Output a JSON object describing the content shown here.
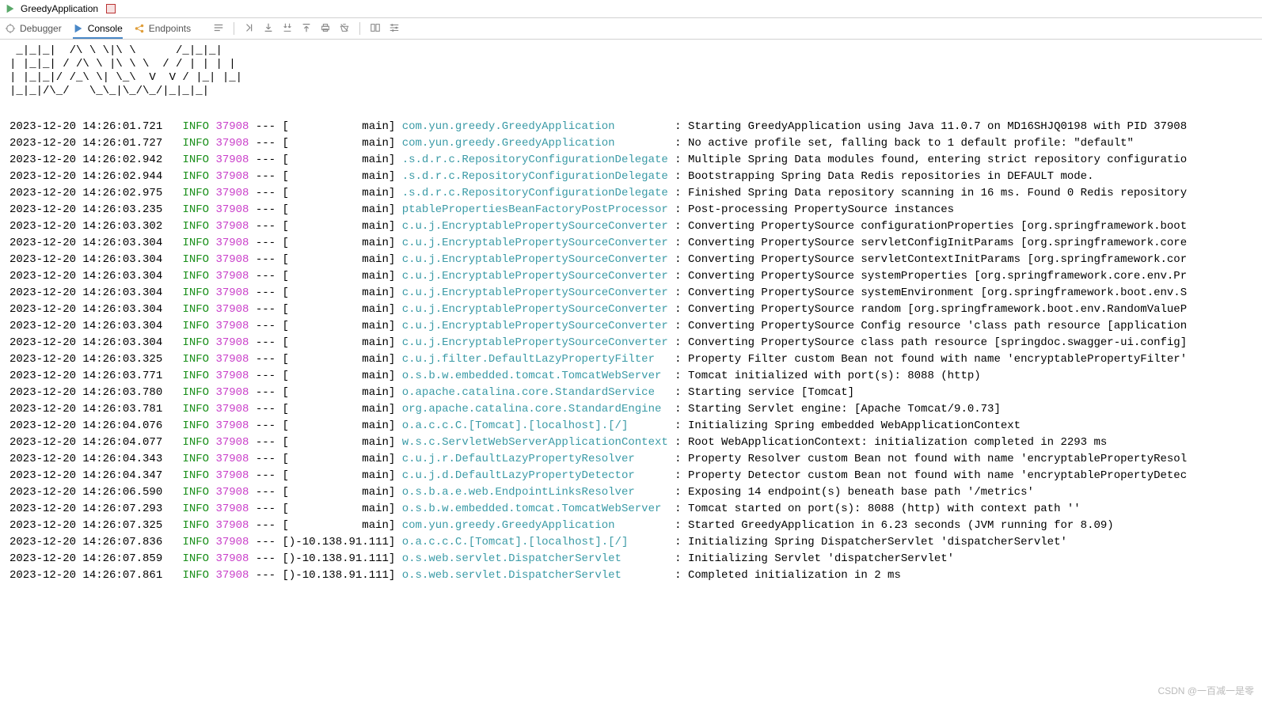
{
  "title": "GreedyApplication",
  "tabs": {
    "debugger": "Debugger",
    "console": "Console",
    "endpoints": "Endpoints"
  },
  "ascii": " _|_|_|  /\\ \\ \\|\\ \\      /_|_|_|\n| |_|_| / /\\ \\ |\\ \\ \\  / / | | | |\n| |_|_|/ /_\\ \\| \\_\\  V  V / |_| |_|\n|_|_|/\\_/   \\_\\_|\\_/\\_/|_|_|_|",
  "watermark": "CSDN @一百减一是零",
  "log": [
    {
      "ts": "2023-12-20 14:26:01.721",
      "lvl": "INFO",
      "pid": "37908",
      "thr": "main",
      "cls": "com.yun.greedy.GreedyApplication",
      "msg": "Starting GreedyApplication using Java 11.0.7 on MD16SHJQ0198 with PID 37908"
    },
    {
      "ts": "2023-12-20 14:26:01.727",
      "lvl": "INFO",
      "pid": "37908",
      "thr": "main",
      "cls": "com.yun.greedy.GreedyApplication",
      "msg": "No active profile set, falling back to 1 default profile: \"default\""
    },
    {
      "ts": "2023-12-20 14:26:02.942",
      "lvl": "INFO",
      "pid": "37908",
      "thr": "main",
      "cls": ".s.d.r.c.RepositoryConfigurationDelegate",
      "msg": "Multiple Spring Data modules found, entering strict repository configuratio"
    },
    {
      "ts": "2023-12-20 14:26:02.944",
      "lvl": "INFO",
      "pid": "37908",
      "thr": "main",
      "cls": ".s.d.r.c.RepositoryConfigurationDelegate",
      "msg": "Bootstrapping Spring Data Redis repositories in DEFAULT mode."
    },
    {
      "ts": "2023-12-20 14:26:02.975",
      "lvl": "INFO",
      "pid": "37908",
      "thr": "main",
      "cls": ".s.d.r.c.RepositoryConfigurationDelegate",
      "msg": "Finished Spring Data repository scanning in 16 ms. Found 0 Redis repository"
    },
    {
      "ts": "2023-12-20 14:26:03.235",
      "lvl": "INFO",
      "pid": "37908",
      "thr": "main",
      "cls": "ptablePropertiesBeanFactoryPostProcessor",
      "msg": "Post-processing PropertySource instances"
    },
    {
      "ts": "2023-12-20 14:26:03.302",
      "lvl": "INFO",
      "pid": "37908",
      "thr": "main",
      "cls": "c.u.j.EncryptablePropertySourceConverter",
      "msg": "Converting PropertySource configurationProperties [org.springframework.boot"
    },
    {
      "ts": "2023-12-20 14:26:03.304",
      "lvl": "INFO",
      "pid": "37908",
      "thr": "main",
      "cls": "c.u.j.EncryptablePropertySourceConverter",
      "msg": "Converting PropertySource servletConfigInitParams [org.springframework.core"
    },
    {
      "ts": "2023-12-20 14:26:03.304",
      "lvl": "INFO",
      "pid": "37908",
      "thr": "main",
      "cls": "c.u.j.EncryptablePropertySourceConverter",
      "msg": "Converting PropertySource servletContextInitParams [org.springframework.cor"
    },
    {
      "ts": "2023-12-20 14:26:03.304",
      "lvl": "INFO",
      "pid": "37908",
      "thr": "main",
      "cls": "c.u.j.EncryptablePropertySourceConverter",
      "msg": "Converting PropertySource systemProperties [org.springframework.core.env.Pr"
    },
    {
      "ts": "2023-12-20 14:26:03.304",
      "lvl": "INFO",
      "pid": "37908",
      "thr": "main",
      "cls": "c.u.j.EncryptablePropertySourceConverter",
      "msg": "Converting PropertySource systemEnvironment [org.springframework.boot.env.S"
    },
    {
      "ts": "2023-12-20 14:26:03.304",
      "lvl": "INFO",
      "pid": "37908",
      "thr": "main",
      "cls": "c.u.j.EncryptablePropertySourceConverter",
      "msg": "Converting PropertySource random [org.springframework.boot.env.RandomValueP"
    },
    {
      "ts": "2023-12-20 14:26:03.304",
      "lvl": "INFO",
      "pid": "37908",
      "thr": "main",
      "cls": "c.u.j.EncryptablePropertySourceConverter",
      "msg": "Converting PropertySource Config resource 'class path resource [application"
    },
    {
      "ts": "2023-12-20 14:26:03.304",
      "lvl": "INFO",
      "pid": "37908",
      "thr": "main",
      "cls": "c.u.j.EncryptablePropertySourceConverter",
      "msg": "Converting PropertySource class path resource [springdoc.swagger-ui.config]"
    },
    {
      "ts": "2023-12-20 14:26:03.325",
      "lvl": "INFO",
      "pid": "37908",
      "thr": "main",
      "cls": "c.u.j.filter.DefaultLazyPropertyFilter",
      "msg": "Property Filter custom Bean not found with name 'encryptablePropertyFilter'"
    },
    {
      "ts": "2023-12-20 14:26:03.771",
      "lvl": "INFO",
      "pid": "37908",
      "thr": "main",
      "cls": "o.s.b.w.embedded.tomcat.TomcatWebServer",
      "msg": "Tomcat initialized with port(s): 8088 (http)"
    },
    {
      "ts": "2023-12-20 14:26:03.780",
      "lvl": "INFO",
      "pid": "37908",
      "thr": "main",
      "cls": "o.apache.catalina.core.StandardService",
      "msg": "Starting service [Tomcat]"
    },
    {
      "ts": "2023-12-20 14:26:03.781",
      "lvl": "INFO",
      "pid": "37908",
      "thr": "main",
      "cls": "org.apache.catalina.core.StandardEngine",
      "msg": "Starting Servlet engine: [Apache Tomcat/9.0.73]"
    },
    {
      "ts": "2023-12-20 14:26:04.076",
      "lvl": "INFO",
      "pid": "37908",
      "thr": "main",
      "cls": "o.a.c.c.C.[Tomcat].[localhost].[/]",
      "msg": "Initializing Spring embedded WebApplicationContext"
    },
    {
      "ts": "2023-12-20 14:26:04.077",
      "lvl": "INFO",
      "pid": "37908",
      "thr": "main",
      "cls": "w.s.c.ServletWebServerApplicationContext",
      "msg": "Root WebApplicationContext: initialization completed in 2293 ms"
    },
    {
      "ts": "2023-12-20 14:26:04.343",
      "lvl": "INFO",
      "pid": "37908",
      "thr": "main",
      "cls": "c.u.j.r.DefaultLazyPropertyResolver",
      "msg": "Property Resolver custom Bean not found with name 'encryptablePropertyResol"
    },
    {
      "ts": "2023-12-20 14:26:04.347",
      "lvl": "INFO",
      "pid": "37908",
      "thr": "main",
      "cls": "c.u.j.d.DefaultLazyPropertyDetector",
      "msg": "Property Detector custom Bean not found with name 'encryptablePropertyDetec"
    },
    {
      "ts": "2023-12-20 14:26:06.590",
      "lvl": "INFO",
      "pid": "37908",
      "thr": "main",
      "cls": "o.s.b.a.e.web.EndpointLinksResolver",
      "msg": "Exposing 14 endpoint(s) beneath base path '/metrics'"
    },
    {
      "ts": "2023-12-20 14:26:07.293",
      "lvl": "INFO",
      "pid": "37908",
      "thr": "main",
      "cls": "o.s.b.w.embedded.tomcat.TomcatWebServer",
      "msg": "Tomcat started on port(s): 8088 (http) with context path ''"
    },
    {
      "ts": "2023-12-20 14:26:07.325",
      "lvl": "INFO",
      "pid": "37908",
      "thr": "main",
      "cls": "com.yun.greedy.GreedyApplication",
      "msg": "Started GreedyApplication in 6.23 seconds (JVM running for 8.09)"
    },
    {
      "ts": "2023-12-20 14:26:07.836",
      "lvl": "INFO",
      "pid": "37908",
      "thr": ")-10.138.91.111",
      "cls": "o.a.c.c.C.[Tomcat].[localhost].[/]",
      "msg": "Initializing Spring DispatcherServlet 'dispatcherServlet'"
    },
    {
      "ts": "2023-12-20 14:26:07.859",
      "lvl": "INFO",
      "pid": "37908",
      "thr": ")-10.138.91.111",
      "cls": "o.s.web.servlet.DispatcherServlet",
      "msg": "Initializing Servlet 'dispatcherServlet'"
    },
    {
      "ts": "2023-12-20 14:26:07.861",
      "lvl": "INFO",
      "pid": "37908",
      "thr": ")-10.138.91.111",
      "cls": "o.s.web.servlet.DispatcherServlet",
      "msg": "Completed initialization in 2 ms"
    }
  ]
}
